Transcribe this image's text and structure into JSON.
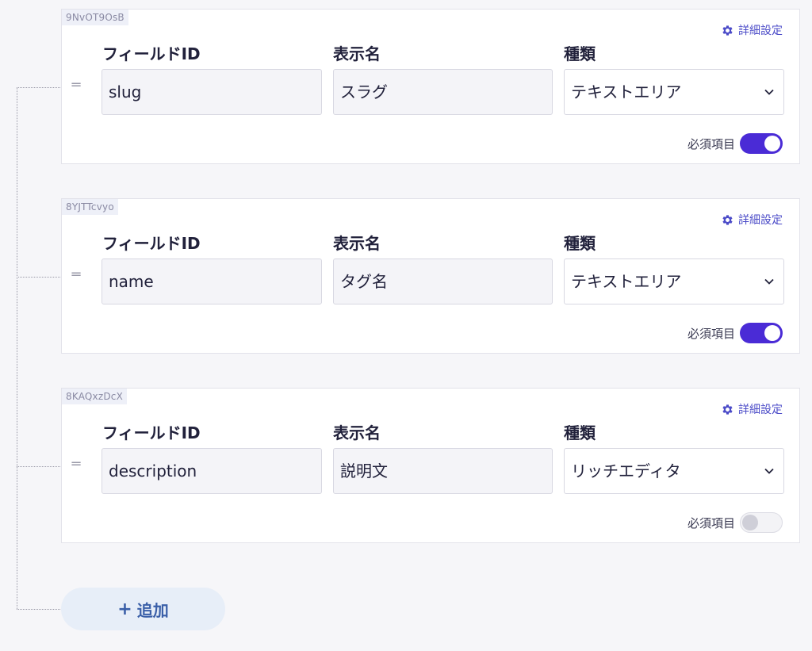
{
  "labels": {
    "field_id": "フィールドID",
    "display_name": "表示名",
    "type": "種類",
    "settings": "詳細設定",
    "required": "必須項目"
  },
  "fields": [
    {
      "id_tag": "9NvOT9OsB",
      "field_id": "slug",
      "display_name": "スラグ",
      "type": "テキストエリア",
      "required": true
    },
    {
      "id_tag": "8YJTTcvyo",
      "field_id": "name",
      "display_name": "タグ名",
      "type": "テキストエリア",
      "required": true
    },
    {
      "id_tag": "8KAQxzDcX",
      "field_id": "description",
      "display_name": "説明文",
      "type": "リッチエディタ",
      "required": false
    }
  ],
  "add_button": {
    "plus": "+",
    "label": "追加"
  },
  "colors": {
    "toggle_on": "#4a2bd6",
    "settings_link": "#4b4bc8",
    "add_button_bg": "#e7eef8",
    "add_button_text": "#3a5fa8"
  },
  "icons": {
    "settings": "gear-icon",
    "drag": "drag-handle-icon",
    "select": "chevron-down-icon"
  }
}
